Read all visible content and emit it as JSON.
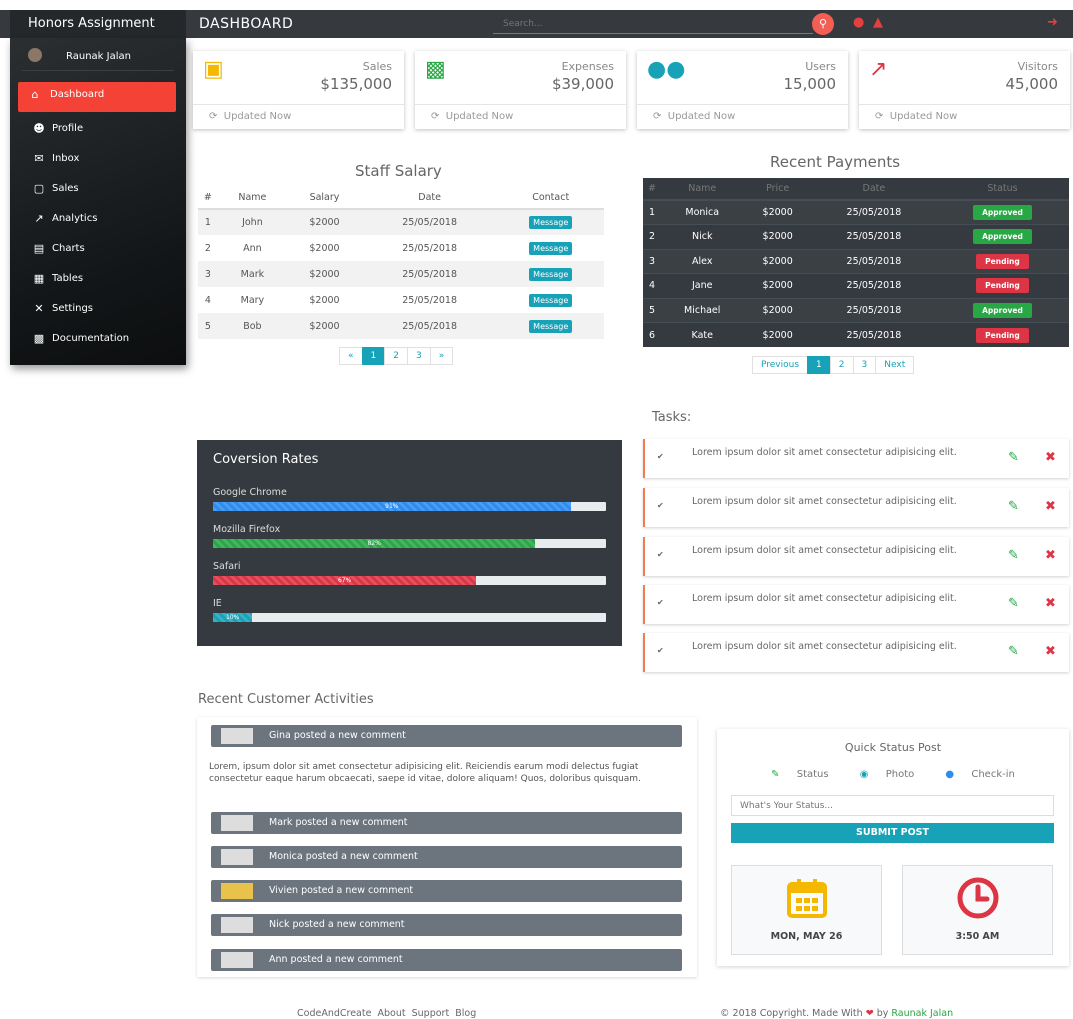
{
  "header": {
    "brand": "Honors Assignment",
    "title": "DASHBOARD",
    "search_placeholder": "Search..."
  },
  "sidebar": {
    "user": "Raunak Jalan",
    "items": [
      {
        "label": "Dashboard",
        "icon": "home-icon"
      },
      {
        "label": "Profile",
        "icon": "user-icon"
      },
      {
        "label": "Inbox",
        "icon": "envelope-icon"
      },
      {
        "label": "Sales",
        "icon": "cart-icon"
      },
      {
        "label": "Analytics",
        "icon": "area-chart-icon"
      },
      {
        "label": "Charts",
        "icon": "bar-chart-icon"
      },
      {
        "label": "Tables",
        "icon": "table-icon"
      },
      {
        "label": "Settings",
        "icon": "wrench-icon"
      },
      {
        "label": "Documentation",
        "icon": "file-icon"
      }
    ]
  },
  "cards": [
    {
      "label": "Sales",
      "value": "$135,000",
      "footer": "Updated Now",
      "icon": "cart-icon",
      "color": "#f5b800"
    },
    {
      "label": "Expenses",
      "value": "$39,000",
      "footer": "Updated Now",
      "icon": "money-icon",
      "color": "#28a745"
    },
    {
      "label": "Users",
      "value": "15,000",
      "footer": "Updated Now",
      "icon": "users-icon",
      "color": "#17a2b8"
    },
    {
      "label": "Visitors",
      "value": "45,000",
      "footer": "Updated Now",
      "icon": "line-chart-icon",
      "color": "#dc3545"
    }
  ],
  "staff": {
    "title": "Staff Salary",
    "headers": [
      "#",
      "Name",
      "Salary",
      "Date",
      "Contact"
    ],
    "rows": [
      [
        "1",
        "John",
        "$2000",
        "25/05/2018",
        "Message"
      ],
      [
        "2",
        "Ann",
        "$2000",
        "25/05/2018",
        "Message"
      ],
      [
        "3",
        "Mark",
        "$2000",
        "25/05/2018",
        "Message"
      ],
      [
        "4",
        "Mary",
        "$2000",
        "25/05/2018",
        "Message"
      ],
      [
        "5",
        "Bob",
        "$2000",
        "25/05/2018",
        "Message"
      ]
    ],
    "pagination": [
      "«",
      "1",
      "2",
      "3",
      "»"
    ]
  },
  "payments": {
    "title": "Recent Payments",
    "headers": [
      "#",
      "Name",
      "Price",
      "Date",
      "Status"
    ],
    "rows": [
      [
        "1",
        "Monica",
        "$2000",
        "25/05/2018",
        "Approved"
      ],
      [
        "2",
        "Nick",
        "$2000",
        "25/05/2018",
        "Approved"
      ],
      [
        "3",
        "Alex",
        "$2000",
        "25/05/2018",
        "Pending"
      ],
      [
        "4",
        "Jane",
        "$2000",
        "25/05/2018",
        "Pending"
      ],
      [
        "5",
        "Michael",
        "$2000",
        "25/05/2018",
        "Approved"
      ],
      [
        "6",
        "Kate",
        "$2000",
        "25/05/2018",
        "Pending"
      ]
    ],
    "pagination": [
      "Previous",
      "1",
      "2",
      "3",
      "Next"
    ]
  },
  "conversion": {
    "title": "Coversion Rates",
    "bars": [
      {
        "label": "Google Chrome",
        "percent": 91,
        "text": "91%",
        "color": "#2d8cf0"
      },
      {
        "label": "Mozilla Firefox",
        "percent": 82,
        "text": "82%",
        "color": "#28a745"
      },
      {
        "label": "Safari",
        "percent": 67,
        "text": "67%",
        "color": "#dc3545"
      },
      {
        "label": "IE",
        "percent": 10,
        "text": "10%",
        "color": "#17a2b8"
      }
    ]
  },
  "tasks": {
    "title": "Tasks:",
    "items": [
      "Lorem ipsum dolor sit amet consectetur adipisicing elit.",
      "Lorem ipsum dolor sit amet consectetur adipisicing elit.",
      "Lorem ipsum dolor sit amet consectetur adipisicing elit.",
      "Lorem ipsum dolor sit amet consectetur adipisicing elit.",
      "Lorem ipsum dolor sit amet consectetur adipisicing elit."
    ]
  },
  "activities": {
    "title": "Recent Customer Activities",
    "first": "Gina posted a new comment",
    "body": "Lorem, ipsum dolor sit amet consectetur adipisicing elit. Reiciendis earum modi delectus fugiat consectetur eaque harum obcaecati, saepe id vitae, dolore aliquam! Quos, doloribus quisquam.",
    "others": [
      "Mark posted a new comment",
      "Monica posted a new comment",
      "Vivien posted a new comment",
      "Nick posted a new comment",
      "Ann posted a new comment"
    ]
  },
  "quick": {
    "title": "Quick Status Post",
    "options": [
      "Status",
      "Photo",
      "Check-in"
    ],
    "placeholder": "What's Your Status...",
    "button": "SUBMIT POST",
    "date": "MON, MAY 26",
    "time": "3:50 AM"
  },
  "footer": {
    "links": [
      "CodeAndCreate",
      "About",
      "Support",
      "Blog"
    ],
    "copyright": "© 2018 Copyright. Made With",
    "by": "by",
    "author": "Raunak Jalan"
  }
}
